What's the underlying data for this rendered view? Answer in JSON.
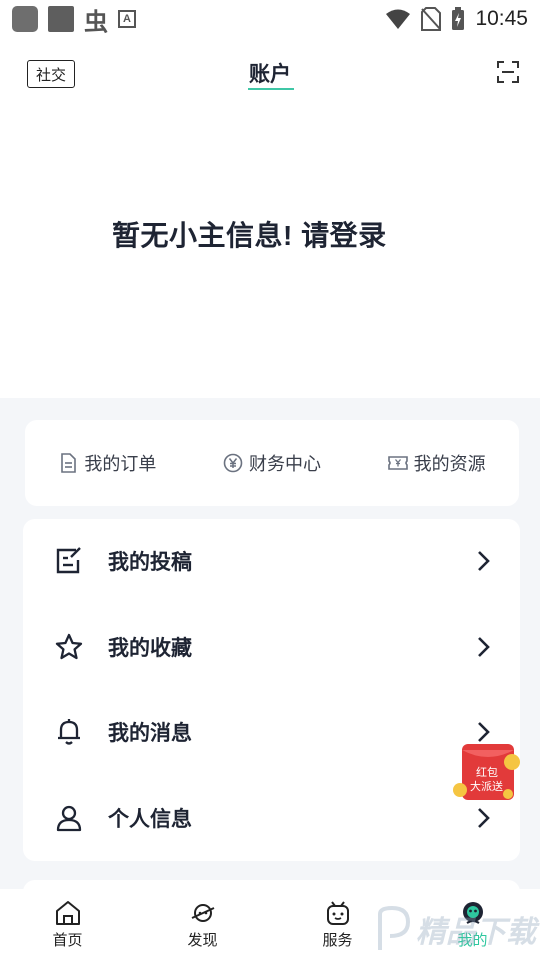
{
  "status_bar": {
    "time": "10:45",
    "left_icons": [
      "app-icon",
      "app-icon",
      "bug-icon",
      "a-icon"
    ],
    "right_icons": [
      "wifi-icon",
      "no-sim-icon",
      "battery-charging-icon"
    ]
  },
  "header": {
    "social_label": "社交",
    "title": "账户",
    "scan_icon": "scan-icon",
    "accent_color": "#3fc7a6"
  },
  "login_prompt": "暂无小主信息! 请登录",
  "quick_links": [
    {
      "label": "我的订单",
      "icon": "document-icon"
    },
    {
      "label": "财务中心",
      "icon": "yen-icon"
    },
    {
      "label": "我的资源",
      "icon": "ticket-icon"
    }
  ],
  "menu": [
    {
      "label": "我的投稿",
      "icon": "edit-icon"
    },
    {
      "label": "我的收藏",
      "icon": "star-icon"
    },
    {
      "label": "我的消息",
      "icon": "bell-icon"
    },
    {
      "label": "个人信息",
      "icon": "user-icon"
    }
  ],
  "float_badge": {
    "text_line1": "红包",
    "text_line2": "大派送",
    "color": "#e23a3a"
  },
  "bottom_nav": [
    {
      "label": "首页",
      "icon": "home-icon",
      "active": false
    },
    {
      "label": "发现",
      "icon": "planet-icon",
      "active": false
    },
    {
      "label": "服务",
      "icon": "robot-icon",
      "active": false
    },
    {
      "label": "我的",
      "icon": "profile-icon",
      "active": true
    }
  ],
  "watermark": "精品下载"
}
